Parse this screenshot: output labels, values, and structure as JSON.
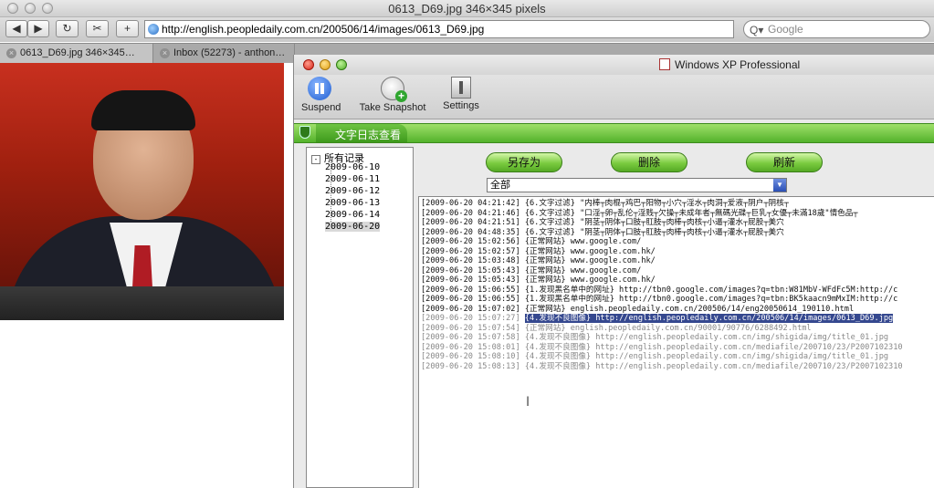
{
  "browser": {
    "window_title": "0613_D69.jpg 346×345 pixels",
    "url": "http://english.peopledaily.com.cn/200506/14/images/0613_D69.jpg",
    "search_placeholder": "Google",
    "search_icon_glyph": "Q▾",
    "tabs": [
      {
        "label": "0613_D69.jpg 346×345…"
      },
      {
        "label": "Inbox (52273) - anthon…"
      }
    ],
    "buttons": {
      "back": "◀",
      "forward": "▶",
      "reload": "↻",
      "snapback": "✂",
      "add": "+"
    }
  },
  "app": {
    "window_title": "Windows XP Professional",
    "toolbar": [
      {
        "label": "Suspend",
        "icon": "pause-icon"
      },
      {
        "label": "Take Snapshot",
        "icon": "snapshot-icon"
      },
      {
        "label": "Settings",
        "icon": "settings-icon"
      }
    ],
    "section_tab": "文字日志查看",
    "tree": {
      "root": "所有记录",
      "expander": "-",
      "dates": [
        "2009-06-10",
        "2009-06-11",
        "2009-06-12",
        "2009-06-13",
        "2009-06-14",
        "2009-06-20"
      ],
      "selected_index": 5
    },
    "actions": {
      "save_as": "另存为",
      "delete": "删除",
      "refresh": "刷新"
    },
    "filter": {
      "value": "全部",
      "arrow": "▼"
    },
    "log": [
      "[2009-06-20 04:21:42] {6.文字过滤} \"内棒┬肉棍┬鸡巴┬阳物┬小穴┬淫水┬肉洞┬爱液┬阴户┬阴核┬",
      "[2009-06-20 04:21:46] {6.文字过滤} \"口淫┬卵┬乱伦┬淫贱┬欠操┬未成年者┬無碼光碟┬巨乳┬女優┬未滿18歲\"情色品┬",
      "[2009-06-20 04:21:51] {6.文字过滤} \"阴茎┬阴体┬口肢┬肛肢┬肉棒┬肉核┬小逼┬灌水┬屁股┬美穴",
      "[2009-06-20 04:48:35] {6.文字过滤} \"阴茎┬阴体┬口肢┬肛肢┬肉棒┬肉核┬小逼┬灌水┬屁股┬美穴",
      "[2009-06-20 15:02:56] {正常网站} www.google.com/",
      "[2009-06-20 15:02:57] {正常网站} www.google.com.hk/",
      "[2009-06-20 15:03:48] {正常网站} www.google.com.hk/",
      "[2009-06-20 15:05:43] {正常网站} www.google.com/",
      "[2009-06-20 15:05:43] {正常网站} www.google.com.hk/",
      "[2009-06-20 15:06:55] {1.发现黑名单中的网址} http://tbn0.google.com/images?q=tbn:W81MbV-WFdFc5M:http://c",
      "[2009-06-20 15:06:55] {1.发现黑名单中的网址} http://tbn0.google.com/images?q=tbn:BK5kaacn9mMxIM:http://c",
      "[2009-06-20 15:07:02] {正常网站} english.peopledaily.com.cn/200506/14/eng20050614_190110.html",
      "[2009-06-20 15:07:27] {4.发现不良图像} http://english.peopledaily.com.cn/200506/14/images/0613_D69.jpg",
      "[2009-06-20 15:07:54] {正常网站} english.peopledaily.com.cn/90001/90776/6288492.html",
      "[2009-06-20 15:07:58] {4.发现不良图像} http://english.peopledaily.com.cn/img/shigida/img/title_01.jpg",
      "[2009-06-20 15:08:01] {4.发现不良图像} http://english.peopledaily.com.cn/mediafile/200710/23/P2007102310",
      "[2009-06-20 15:08:10] {4.发现不良图像} http://english.peopledaily.com.cn/img/shigida/img/title_01.jpg",
      "[2009-06-20 15:08:13] {4.发现不良图像} http://english.peopledaily.com.cn/mediafile/200710/23/P2007102310"
    ],
    "highlighted_index": 12,
    "dimmed_range": [
      12,
      17
    ]
  }
}
